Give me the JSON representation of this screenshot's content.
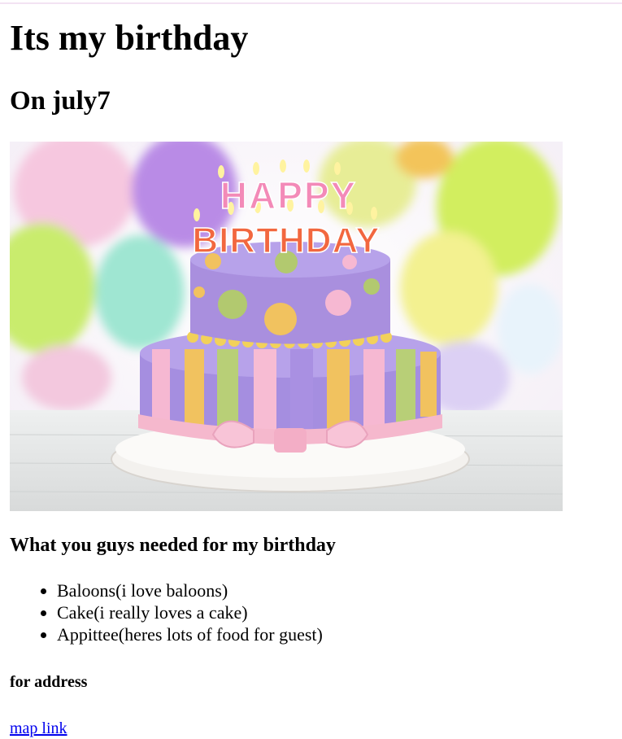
{
  "page": {
    "title": "Its my birthday",
    "subtitle": "On july7"
  },
  "image": {
    "alt": "Happy Birthday cake with candles and balloons",
    "candle_text_top": "HAPPY",
    "candle_text_bottom": "BIRTHDAY"
  },
  "needs": {
    "heading": "What you guys needed for my birthday",
    "items": [
      "Baloons(i love baloons)",
      "Cake(i really loves a cake)",
      "Appittee(heres lots of food for guest)"
    ]
  },
  "address": {
    "heading": "for address",
    "link_label": "map link"
  }
}
